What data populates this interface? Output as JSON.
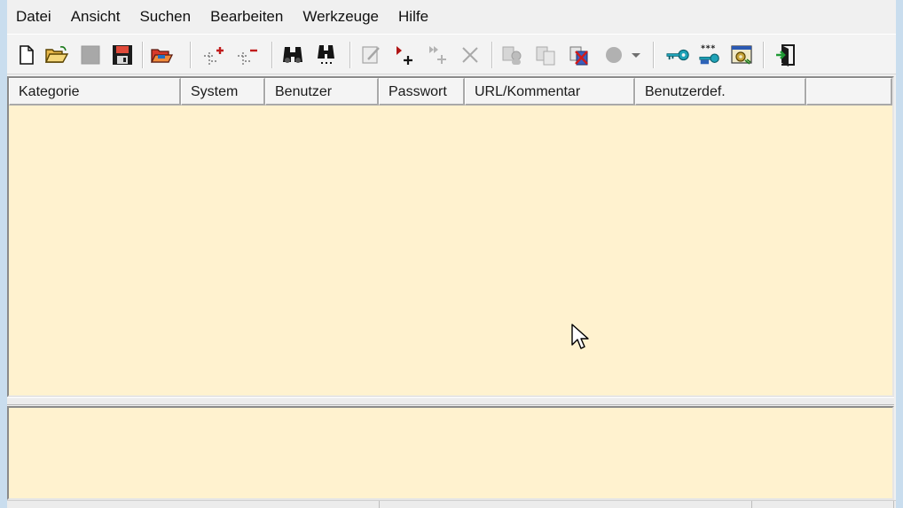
{
  "menubar": {
    "items": [
      {
        "id": "datei",
        "label": "Datei"
      },
      {
        "id": "ansicht",
        "label": "Ansicht"
      },
      {
        "id": "suchen",
        "label": "Suchen"
      },
      {
        "id": "bearbeiten",
        "label": "Bearbeiten"
      },
      {
        "id": "werkzeuge",
        "label": "Werkzeuge"
      },
      {
        "id": "hilfe",
        "label": "Hilfe"
      }
    ]
  },
  "toolbar": {
    "buttons": [
      {
        "icon": "new-document-icon",
        "enabled": true
      },
      {
        "icon": "open-folder-icon",
        "enabled": true
      },
      {
        "icon": "save-icon",
        "enabled": false
      },
      {
        "icon": "save-as-icon",
        "enabled": true
      },
      {
        "icon": "open-recent-icon",
        "enabled": true
      },
      {
        "icon": "add-category-icon",
        "enabled": true
      },
      {
        "icon": "remove-category-icon",
        "enabled": true
      },
      {
        "icon": "find-icon",
        "enabled": true
      },
      {
        "icon": "find-next-icon",
        "enabled": true
      },
      {
        "icon": "edit-entry-icon",
        "enabled": false
      },
      {
        "icon": "add-entry-icon",
        "enabled": true
      },
      {
        "icon": "add-multiple-entry-icon",
        "enabled": false
      },
      {
        "icon": "delete-entry-icon",
        "enabled": false
      },
      {
        "icon": "copy-user-icon",
        "enabled": false
      },
      {
        "icon": "copy-password-icon",
        "enabled": false
      },
      {
        "icon": "clear-clipboard-icon",
        "enabled": true
      },
      {
        "icon": "open-url-icon",
        "enabled": false
      },
      {
        "icon": "master-password-icon",
        "enabled": true
      },
      {
        "icon": "password-generator-icon",
        "enabled": true
      },
      {
        "icon": "options-icon",
        "enabled": true
      },
      {
        "icon": "exit-icon",
        "enabled": true
      }
    ]
  },
  "colors": {
    "list_background": "#fff2cf",
    "chrome": "#f0f0f0",
    "desktop": "#c9ddee"
  },
  "list": {
    "columns": [
      {
        "id": "kategorie",
        "label": "Kategorie"
      },
      {
        "id": "system",
        "label": "System"
      },
      {
        "id": "benutzer",
        "label": "Benutzer"
      },
      {
        "id": "passwort",
        "label": "Passwort"
      },
      {
        "id": "url",
        "label": "URL/Kommentar"
      },
      {
        "id": "benutzerdef",
        "label": "Benutzerdef."
      },
      {
        "id": "extra",
        "label": ""
      }
    ],
    "rows": []
  }
}
